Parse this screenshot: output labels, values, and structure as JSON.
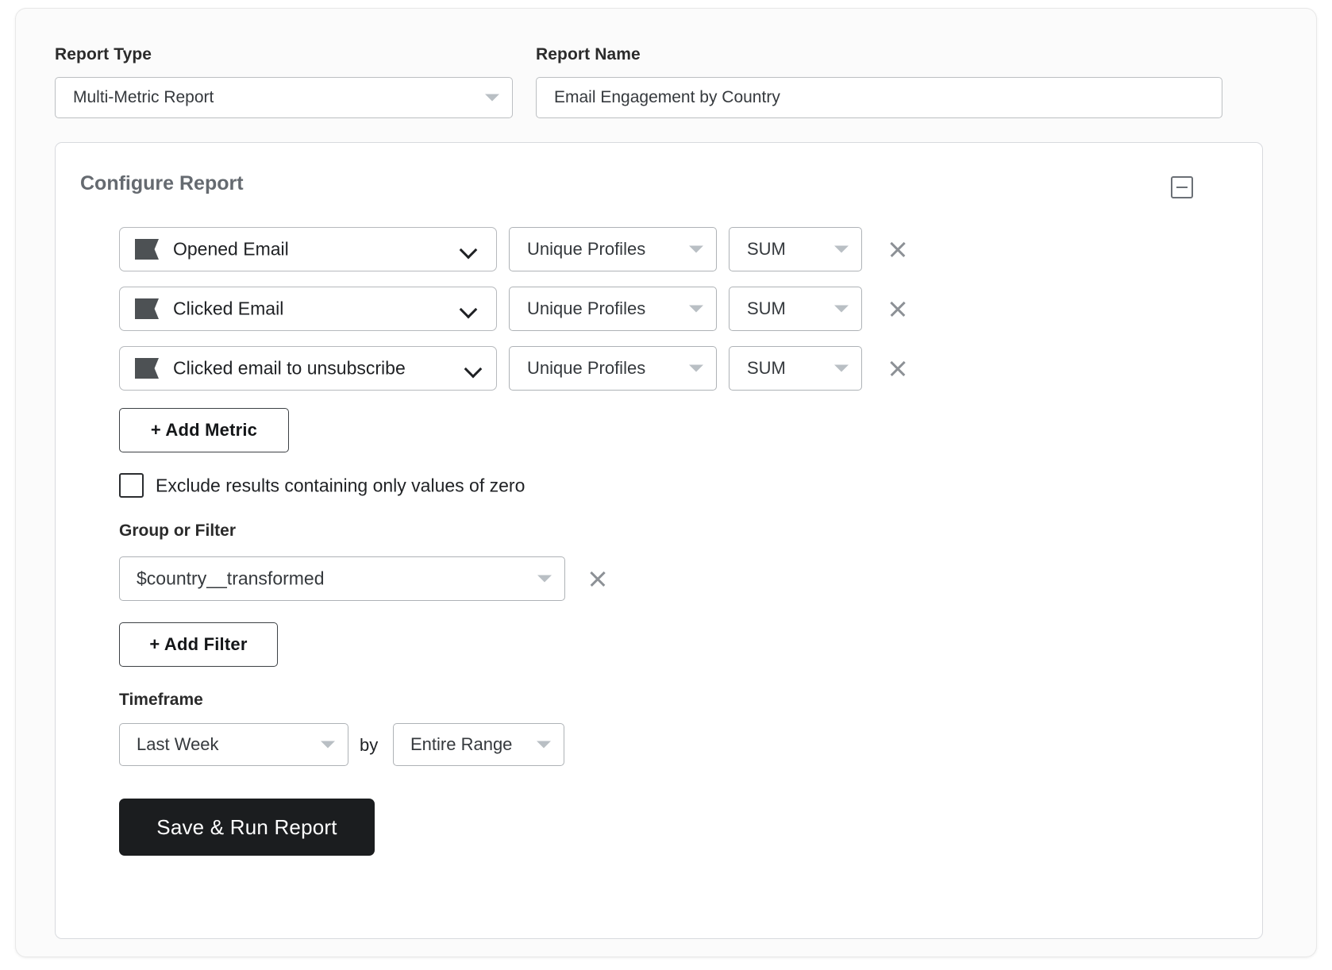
{
  "report_type": {
    "label": "Report Type",
    "value": "Multi-Metric Report"
  },
  "report_name": {
    "label": "Report Name",
    "value": "Email Engagement by Country",
    "placeholder": "Report Name"
  },
  "configure_panel": {
    "title": "Configure Report",
    "collapse_icon": "minus-square-icon"
  },
  "metrics": [
    {
      "icon": "flag-icon",
      "name": "Opened Email",
      "measure": "Unique Profiles",
      "aggregation": "SUM",
      "remove_icon": "close-icon"
    },
    {
      "icon": "flag-icon",
      "name": "Clicked Email",
      "measure": "Unique Profiles",
      "aggregation": "SUM",
      "remove_icon": "close-icon"
    },
    {
      "icon": "flag-icon",
      "name": "Clicked email to unsubscribe",
      "measure": "Unique Profiles",
      "aggregation": "SUM",
      "remove_icon": "close-icon"
    }
  ],
  "add_metric_button": "+ Add Metric",
  "exclude_zero": {
    "label": "Exclude results containing only values of zero",
    "checked": false
  },
  "group_or_filter": {
    "label": "Group or Filter",
    "value": "$country__transformed",
    "remove_icon": "close-icon",
    "add_button": "+ Add Filter"
  },
  "timeframe": {
    "label": "Timeframe",
    "range": "Last Week",
    "conjunction": "by",
    "bucket": "Entire Range"
  },
  "submit_button": "Save & Run Report",
  "colors": {
    "primary_button_bg": "#1b1d1f",
    "metric_icon": "#4d5154",
    "panel_title": "#656a70",
    "border": "#aeb2b6"
  }
}
